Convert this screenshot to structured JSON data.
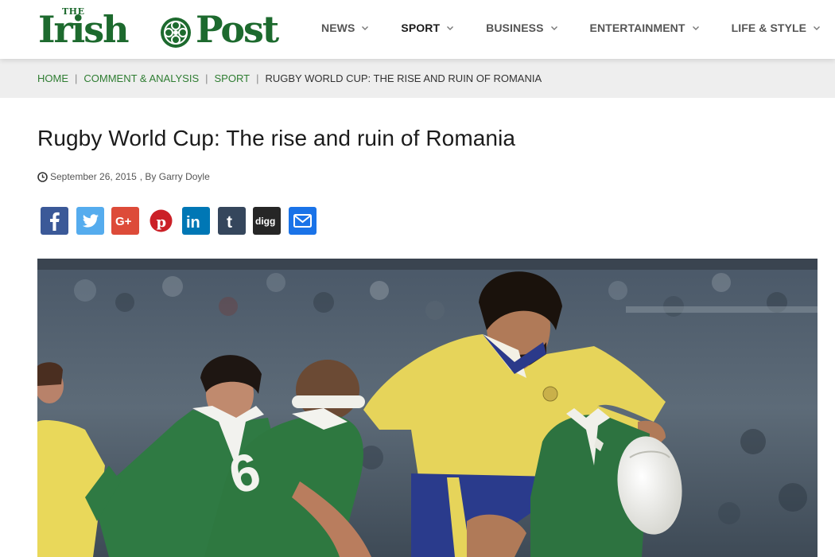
{
  "logo": {
    "the": "THE",
    "word1": "Irish",
    "word2": "Post"
  },
  "nav": [
    {
      "label": "NEWS",
      "active": false
    },
    {
      "label": "SPORT",
      "active": true
    },
    {
      "label": "BUSINESS",
      "active": false
    },
    {
      "label": "ENTERTAINMENT",
      "active": false
    },
    {
      "label": "LIFE & STYLE",
      "active": false
    }
  ],
  "breadcrumb": {
    "items": [
      "HOME",
      "COMMENT & ANALYSIS",
      "SPORT"
    ],
    "separator": "|",
    "current": "RUGBY WORLD CUP: THE RISE AND RUIN OF ROMANIA"
  },
  "article": {
    "title": "Rugby World Cup: The rise and ruin of Romania",
    "date": "September 26, 2015",
    "byline": ", By Garry Doyle",
    "jersey_number": "6"
  },
  "share": [
    {
      "icon": "facebook-icon",
      "color": "#3b5998"
    },
    {
      "icon": "twitter-icon",
      "color": "#55acee"
    },
    {
      "icon": "google-plus-icon",
      "color": "#dd4b39"
    },
    {
      "icon": "pinterest-icon",
      "color": "#cb2027"
    },
    {
      "icon": "linkedin-icon",
      "color": "#0077b5"
    },
    {
      "icon": "tumblr-icon",
      "color": "#35465c"
    },
    {
      "icon": "digg-icon",
      "color": "#262626"
    },
    {
      "icon": "email-icon",
      "color": "#1a73e8"
    }
  ],
  "colors": {
    "brand_green": "#1d6a2e",
    "link_green": "#2f7d32",
    "crumb_bg": "#eeeeee"
  }
}
